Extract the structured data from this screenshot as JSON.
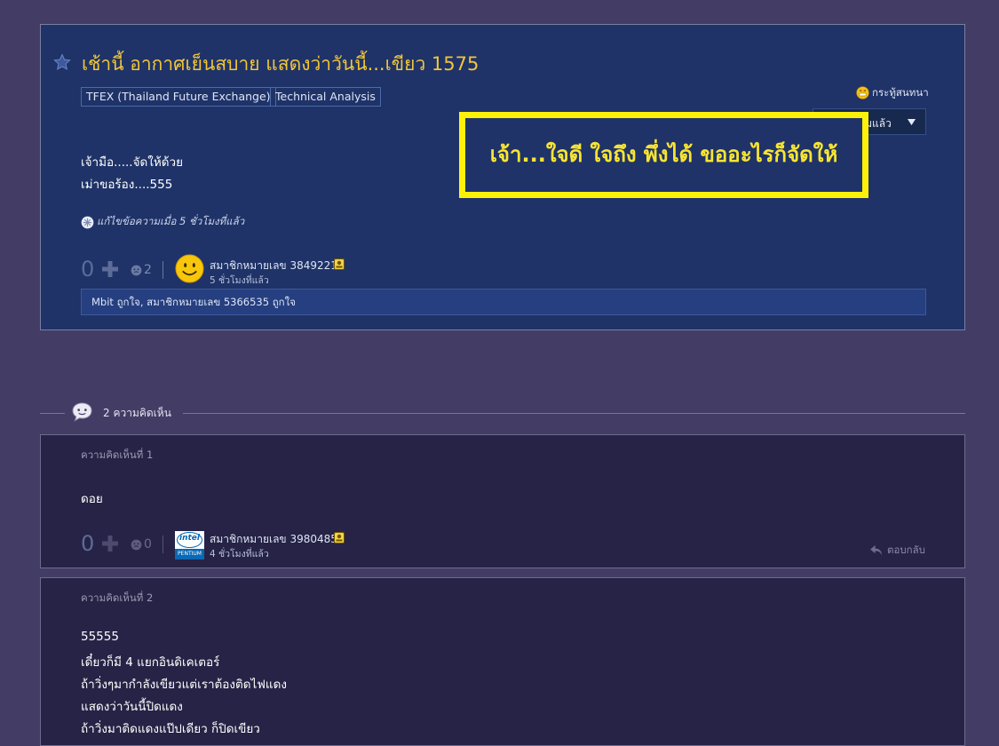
{
  "topic": {
    "title": "เช้านี้ อากาศเย็นสบาย แสดงว่าวันนี้...เขียว 1575",
    "tags": [
      "TFEX (Thailand Future Exchange)",
      "Technical Analysis"
    ],
    "emotion_label": "กระทู้สนทนา",
    "follow_label": "ติดตามแล้ว",
    "body_lines": [
      "เจ้ามือ.....จัดให้ด้วย",
      "เม่าขอร้อง....555"
    ],
    "edit_note": "แก้ไขข้อความเมื่อ 5 ชั่วโมงที่แล้ว",
    "vote_count": "0",
    "emotion_count": "2",
    "member": "สมาชิกหมายเลข 3849221",
    "time_ago": "5 ชั่วโมงที่แล้ว",
    "likes_text": "Mbit ถูกใจ, สมาชิกหมายเลข 5366535 ถูกใจ",
    "callout_text": "เจ้า...ใจดี ใจถึง พึ่งได้ ขออะไรก็จัดให้",
    "callout_color": "#fdf109"
  },
  "comments_header": "2 ความคิดเห็น",
  "comments": [
    {
      "label": "ความคิดเห็นที่ 1",
      "lines": [
        "ดอย"
      ],
      "vote_count": "0",
      "emotion_count": "0",
      "member": "สมาชิกหมายเลข 3980485",
      "time_ago": "4 ชั่วโมงที่แล้ว",
      "avatar_text": "intel",
      "avatar_sub": "PENTIUM",
      "reply_label": "ตอบกลับ"
    },
    {
      "label": "ความคิดเห็นที่ 2",
      "lines": [
        "55555",
        "เดี๋ยวก็มี 4 แยกอินดิเคเตอร์",
        "ถ้าวิ่งๆมากำลังเขียวแต่เราต้องติดไฟแดง",
        "แสดงว่าวันนี้ปิดแดง",
        "ถ้าวิ่งมาติดแดงแป๊ปเดียว ก็ปิดเขียว"
      ]
    }
  ],
  "colors": {
    "page_bg": "#433d65",
    "topic_bg": "#1f3368",
    "title": "#f3c638",
    "comment_bg": "#262346"
  }
}
